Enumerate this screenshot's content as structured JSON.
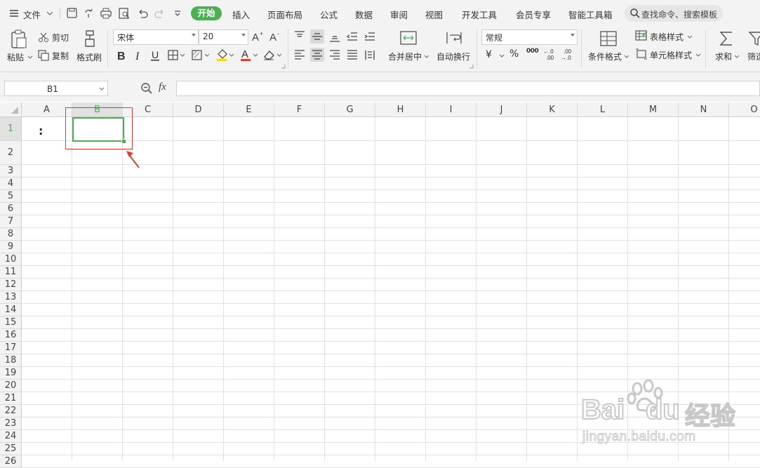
{
  "menubar": {
    "file_label": "文件",
    "tabs": [
      "开始",
      "插入",
      "页面布局",
      "公式",
      "数据",
      "审阅",
      "视图",
      "开发工具",
      "会员专享",
      "智能工具箱"
    ],
    "search_placeholder": "查找命令、搜索模板"
  },
  "ribbon": {
    "paste": "粘贴",
    "cut": "剪切",
    "copy": "复制",
    "format_painter": "格式刷",
    "font_name": "宋体",
    "font_size": "20",
    "merge_center": "合并居中",
    "auto_wrap": "自动换行",
    "number_format": "常规",
    "conditional_format": "条件格式",
    "table_style": "表格样式",
    "cell_style": "单元格样式",
    "sum": "求和",
    "filter": "筛选",
    "currency_symbol": "¥",
    "percent_symbol": "%",
    "thousands_symbol": "000",
    "dec_increase": "+.0\n.00",
    "dec_decrease": "-.00\n.0"
  },
  "formula_bar": {
    "name_box": "B1",
    "fx": "fx",
    "formula": ""
  },
  "grid": {
    "columns": [
      "A",
      "B",
      "C",
      "D",
      "E",
      "F",
      "G",
      "H",
      "I",
      "J",
      "K",
      "L",
      "M",
      "N",
      "O"
    ],
    "rows": [
      "1",
      "2",
      "3",
      "4",
      "5",
      "6",
      "7",
      "8",
      "9",
      "10",
      "11",
      "12",
      "13",
      "14",
      "15",
      "16",
      "17",
      "18",
      "19",
      "20",
      "21",
      "22",
      "23",
      "24",
      "25",
      "26"
    ],
    "selected_cell": "B1",
    "cells": {
      "A1": ":"
    }
  },
  "colors": {
    "accent": "#4caf50",
    "annotation": "#e53935"
  },
  "watermark": {
    "brand_left": "Bai",
    "brand_right": "du",
    "brand_cn": "经验",
    "url": "jingyan.baidu.com"
  }
}
